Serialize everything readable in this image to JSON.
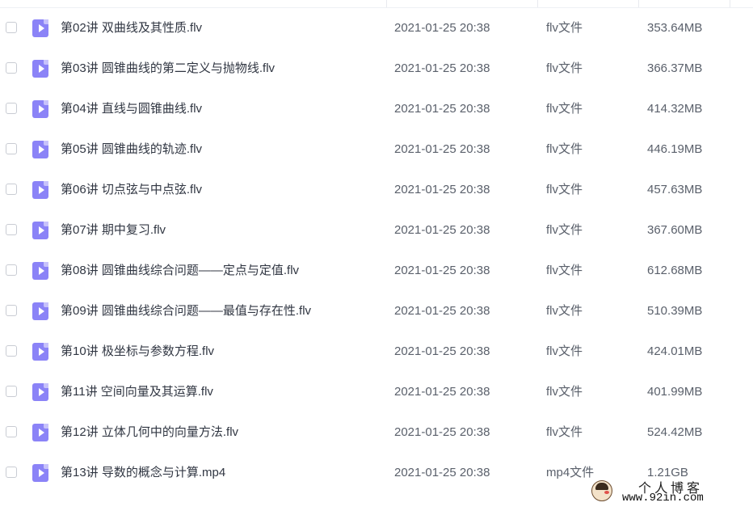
{
  "files": [
    {
      "name": "第02讲 双曲线及其性质.flv",
      "date": "2021-01-25 20:38",
      "type": "flv文件",
      "size": "353.64MB"
    },
    {
      "name": "第03讲 圆锥曲线的第二定义与抛物线.flv",
      "date": "2021-01-25 20:38",
      "type": "flv文件",
      "size": "366.37MB"
    },
    {
      "name": "第04讲 直线与圆锥曲线.flv",
      "date": "2021-01-25 20:38",
      "type": "flv文件",
      "size": "414.32MB"
    },
    {
      "name": "第05讲 圆锥曲线的轨迹.flv",
      "date": "2021-01-25 20:38",
      "type": "flv文件",
      "size": "446.19MB"
    },
    {
      "name": "第06讲 切点弦与中点弦.flv",
      "date": "2021-01-25 20:38",
      "type": "flv文件",
      "size": "457.63MB"
    },
    {
      "name": "第07讲 期中复习.flv",
      "date": "2021-01-25 20:38",
      "type": "flv文件",
      "size": "367.60MB"
    },
    {
      "name": "第08讲 圆锥曲线综合问题——定点与定值.flv",
      "date": "2021-01-25 20:38",
      "type": "flv文件",
      "size": "612.68MB"
    },
    {
      "name": "第09讲 圆锥曲线综合问题——最值与存在性.flv",
      "date": "2021-01-25 20:38",
      "type": "flv文件",
      "size": "510.39MB"
    },
    {
      "name": "第10讲 极坐标与参数方程.flv",
      "date": "2021-01-25 20:38",
      "type": "flv文件",
      "size": "424.01MB"
    },
    {
      "name": "第11讲 空间向量及其运算.flv",
      "date": "2021-01-25 20:38",
      "type": "flv文件",
      "size": "401.99MB"
    },
    {
      "name": "第12讲 立体几何中的向量方法.flv",
      "date": "2021-01-25 20:38",
      "type": "flv文件",
      "size": "524.42MB"
    },
    {
      "name": "第13讲 导数的概念与计算.mp4",
      "date": "2021-01-25 20:38",
      "type": "mp4文件",
      "size": "1.21GB"
    }
  ],
  "icons": {
    "row_icon": "video-file-icon",
    "checkbox": "checkbox"
  },
  "colors": {
    "file_icon": "#8b83f7",
    "text_primary": "#303642",
    "text_secondary": "#5a606b"
  },
  "watermark": {
    "title": "个人博客",
    "url": "www.92in.com"
  }
}
